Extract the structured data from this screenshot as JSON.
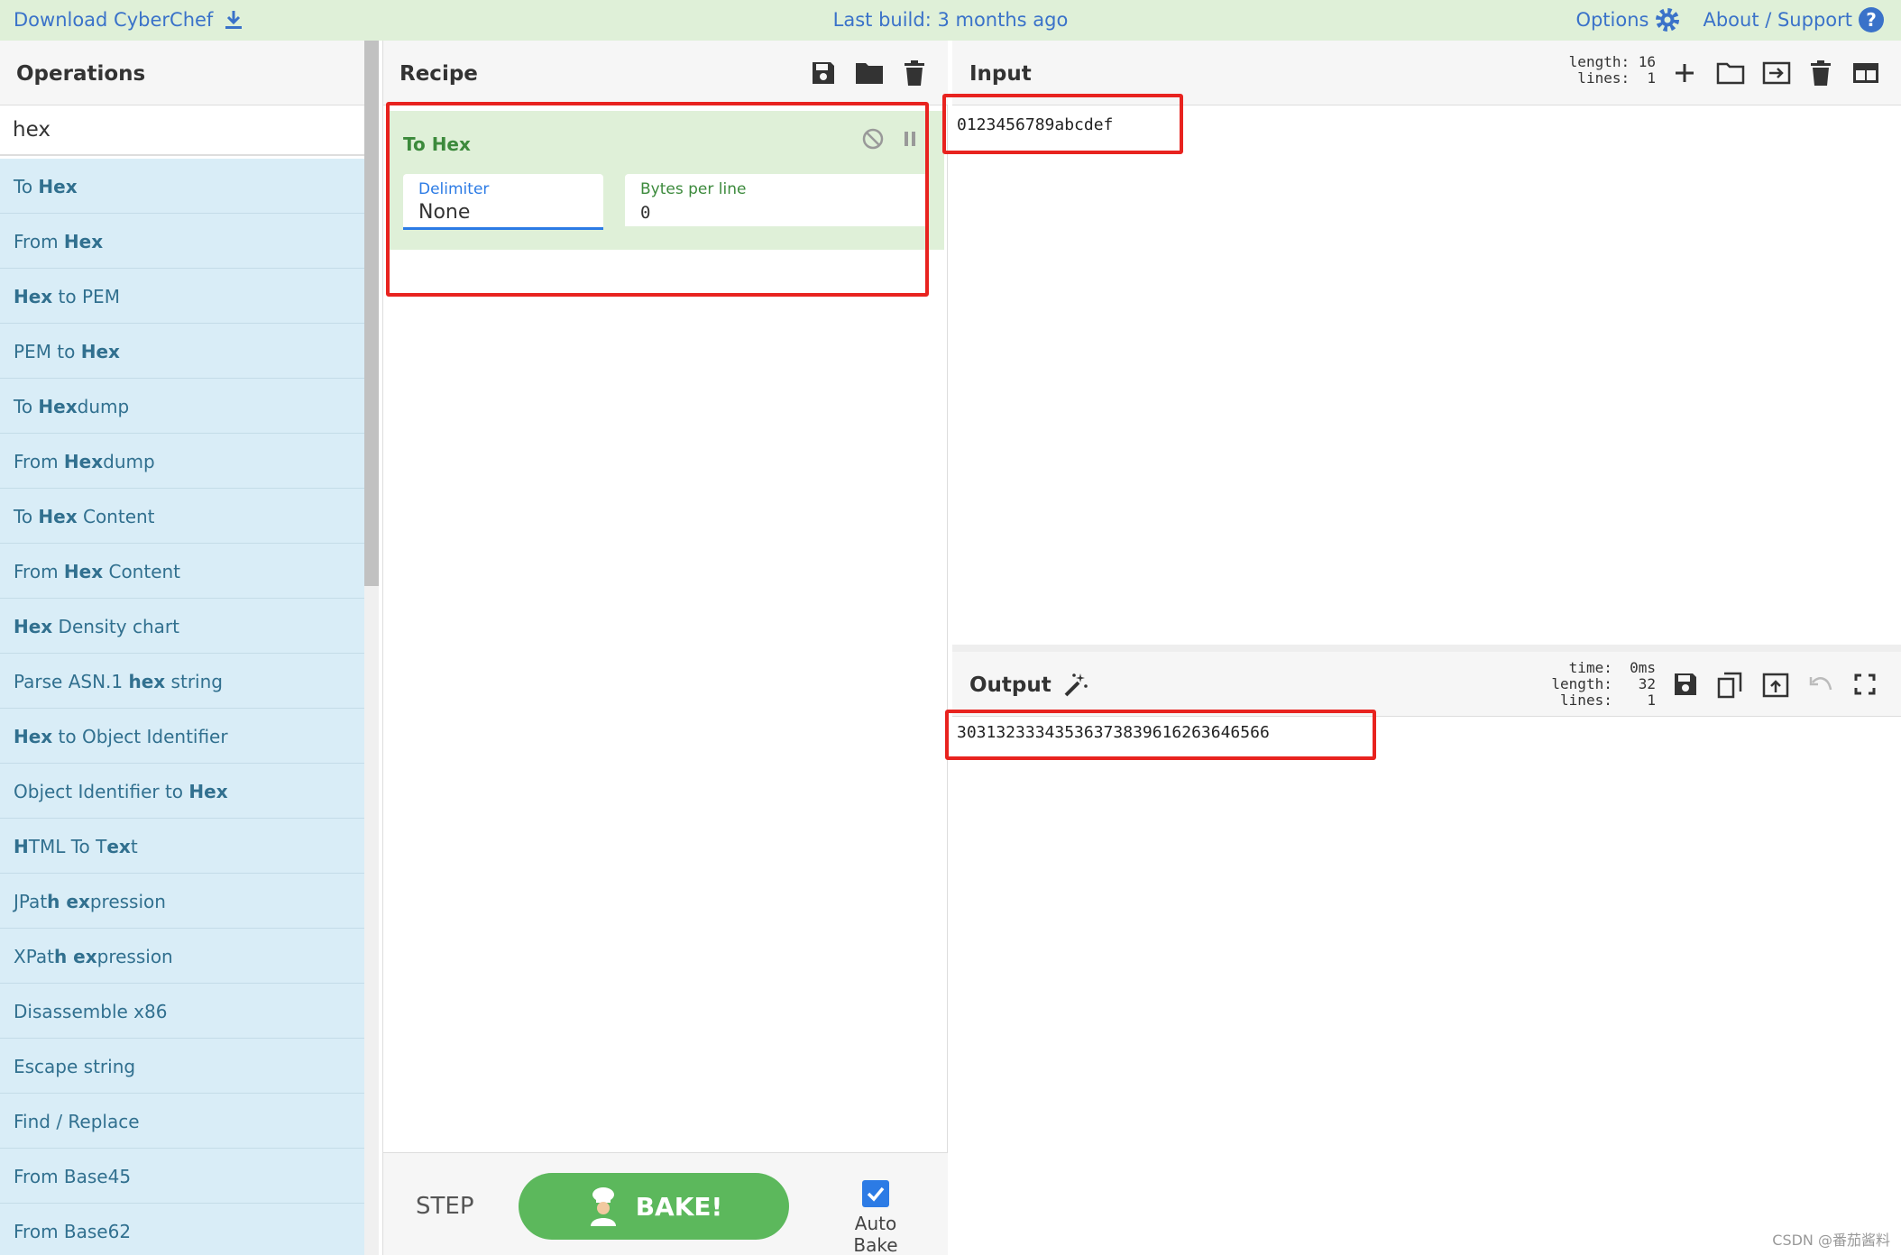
{
  "banner": {
    "download_label": "Download CyberChef",
    "last_build": "Last build: 3 months ago",
    "options_label": "Options",
    "about_label": "About / Support"
  },
  "operations": {
    "title": "Operations",
    "search_value": "hex",
    "items": [
      {
        "parts": [
          {
            "t": "To ",
            "b": false
          },
          {
            "t": "Hex",
            "b": true
          }
        ]
      },
      {
        "parts": [
          {
            "t": "From ",
            "b": false
          },
          {
            "t": "Hex",
            "b": true
          }
        ]
      },
      {
        "parts": [
          {
            "t": "Hex",
            "b": true
          },
          {
            "t": " to PEM",
            "b": false
          }
        ]
      },
      {
        "parts": [
          {
            "t": "PEM to ",
            "b": false
          },
          {
            "t": "Hex",
            "b": true
          }
        ]
      },
      {
        "parts": [
          {
            "t": "To ",
            "b": false
          },
          {
            "t": "Hex",
            "b": true
          },
          {
            "t": "dump",
            "b": false
          }
        ]
      },
      {
        "parts": [
          {
            "t": "From ",
            "b": false
          },
          {
            "t": "Hex",
            "b": true
          },
          {
            "t": "dump",
            "b": false
          }
        ]
      },
      {
        "parts": [
          {
            "t": "To ",
            "b": false
          },
          {
            "t": "Hex",
            "b": true
          },
          {
            "t": " Content",
            "b": false
          }
        ]
      },
      {
        "parts": [
          {
            "t": "From ",
            "b": false
          },
          {
            "t": "Hex",
            "b": true
          },
          {
            "t": " Content",
            "b": false
          }
        ]
      },
      {
        "parts": [
          {
            "t": "Hex",
            "b": true
          },
          {
            "t": " Density chart",
            "b": false
          }
        ]
      },
      {
        "parts": [
          {
            "t": "Parse ASN.1 ",
            "b": false
          },
          {
            "t": "hex",
            "b": true
          },
          {
            "t": " string",
            "b": false
          }
        ]
      },
      {
        "parts": [
          {
            "t": "Hex",
            "b": true
          },
          {
            "t": " to Object Identifier",
            "b": false
          }
        ]
      },
      {
        "parts": [
          {
            "t": "Object Identifier to ",
            "b": false
          },
          {
            "t": "Hex",
            "b": true
          }
        ]
      },
      {
        "parts": [
          {
            "t": "H",
            "b": true
          },
          {
            "t": "TML To T",
            "b": false
          },
          {
            "t": "ex",
            "b": true
          },
          {
            "t": "t",
            "b": false
          }
        ]
      },
      {
        "parts": [
          {
            "t": "JPat",
            "b": false
          },
          {
            "t": "h ex",
            "b": true
          },
          {
            "t": "pression",
            "b": false
          }
        ]
      },
      {
        "parts": [
          {
            "t": "XPat",
            "b": false
          },
          {
            "t": "h ex",
            "b": true
          },
          {
            "t": "pression",
            "b": false
          }
        ]
      },
      {
        "parts": [
          {
            "t": "Disassemble x86",
            "b": false
          }
        ]
      },
      {
        "parts": [
          {
            "t": "Escape string",
            "b": false
          }
        ]
      },
      {
        "parts": [
          {
            "t": "Find / Replace",
            "b": false
          }
        ]
      },
      {
        "parts": [
          {
            "t": "From Base45",
            "b": false
          }
        ]
      },
      {
        "parts": [
          {
            "t": "From Base62",
            "b": false
          }
        ]
      }
    ]
  },
  "recipe": {
    "title": "Recipe",
    "operation": {
      "name": "To Hex",
      "delimiter_label": "Delimiter",
      "delimiter_value": "None",
      "bytes_label": "Bytes per line",
      "bytes_value": "0"
    },
    "step_label": "STEP",
    "bake_label": "BAKE!",
    "auto_bake_label": "Auto Bake",
    "auto_bake_checked": true
  },
  "input": {
    "title": "Input",
    "stats": "length: 16\n lines:  1",
    "text": "0123456789abcdef"
  },
  "output": {
    "title": "Output",
    "stats": "  time:  0ms\nlength:   32\n lines:    1",
    "text": "30313233343536373839616263646566"
  },
  "colors": {
    "banner_bg": "#dff0d8",
    "link_blue": "#3a72c9",
    "op_bg": "#d9edf7",
    "recipe_card_bg": "#dff0d8",
    "bake_green": "#5cb85c",
    "highlight_red": "#e8231f"
  },
  "watermark": "CSDN @番茄酱料"
}
